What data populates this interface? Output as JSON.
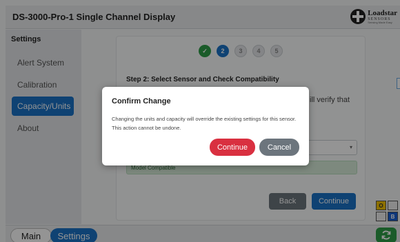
{
  "header": {
    "title": "DS-3000-Pro-1 Single Channel Display"
  },
  "logo": {
    "name": "Loadstar",
    "sub": "SENSORS",
    "tag": "Sensing Made Easy"
  },
  "sidebar": {
    "heading": "Settings",
    "items": [
      {
        "label": "Alert System",
        "active": false
      },
      {
        "label": "Calibration",
        "active": false
      },
      {
        "label": "Capacity/Units",
        "active": true
      },
      {
        "label": "About",
        "active": false
      }
    ]
  },
  "wizard": {
    "steps": [
      {
        "label": "✓",
        "state": "done"
      },
      {
        "label": "2",
        "state": "current"
      },
      {
        "label": "3",
        "state": "todo"
      },
      {
        "label": "4",
        "state": "todo"
      },
      {
        "label": "5",
        "state": "todo"
      }
    ],
    "step_title": "Step 2: Select Sensor and Check Compatibility",
    "partial_text": "ill verify that",
    "compatibility_status": "Model Compatible",
    "back_label": "Back",
    "continue_label": "Continue"
  },
  "indicator_grid": {
    "cells": [
      "O",
      "",
      "",
      "B"
    ]
  },
  "footer": {
    "main_label": "Main",
    "settings_label": "Settings"
  },
  "modal": {
    "title": "Confirm Change",
    "body": "Changing the units and capacity will override the existing settings for this sensor. This action cannot be undone.",
    "continue_label": "Continue",
    "cancel_label": "Cancel"
  },
  "colors": {
    "accent": "#1a73c7",
    "success": "#2e9e47",
    "danger": "#d93040",
    "secondary": "#6c757d"
  }
}
